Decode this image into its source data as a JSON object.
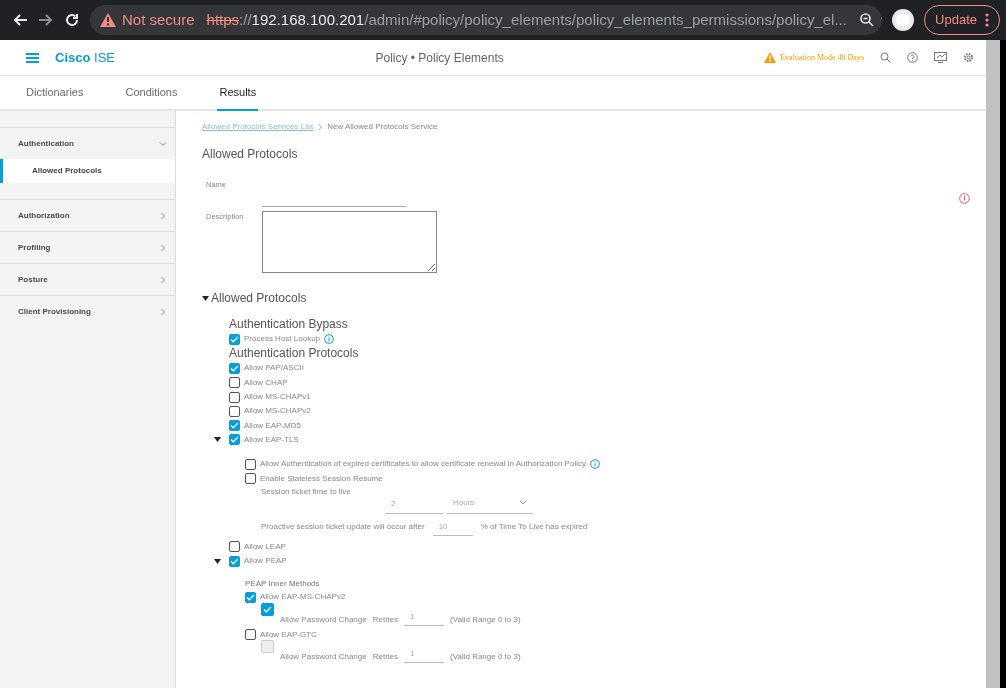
{
  "browser": {
    "security": "Not secure",
    "url_scheme": "https",
    "url_sep": "://",
    "url_host": "192.168.100.201",
    "url_path": "/admin/#policy/policy_elements/policy_elements_permissions/policy_el...",
    "update_button": "Update"
  },
  "app": {
    "brand": "Cisco",
    "brand_suffix": "ISE",
    "page_title": "Policy • Policy Elements",
    "evaluation": "Evaluation Mode 49 Days"
  },
  "tabs": [
    {
      "label": "Dictionaries",
      "selected": false
    },
    {
      "label": "Conditions",
      "selected": false
    },
    {
      "label": "Results",
      "selected": true
    }
  ],
  "sidebar": {
    "sections": [
      {
        "label": "Authentication",
        "expanded": true,
        "children": [
          {
            "label": "Allowed Protocols",
            "selected": true
          }
        ]
      },
      {
        "label": "Authorization",
        "expanded": false
      },
      {
        "label": "Profiling",
        "expanded": false
      },
      {
        "label": "Posture",
        "expanded": false
      },
      {
        "label": "Client Provisioning",
        "expanded": false
      }
    ]
  },
  "breadcrumb": [
    "Allowed Protocols Services List",
    "New Allowed Protocols Service"
  ],
  "heading": "Allowed Protocols",
  "form": {
    "name_label": "Name",
    "description_label": "Description"
  },
  "section": {
    "title": "Allowed Protocols",
    "expanded": true
  },
  "protocols": [
    {
      "kind": "heading",
      "text": "Authentication Bypass"
    },
    {
      "kind": "checkbox",
      "label": "Process Host Lookup",
      "checked": true,
      "info": true
    },
    {
      "kind": "heading",
      "text": "Authentication Protocols"
    },
    {
      "kind": "checkbox",
      "label": "Allow PAP/ASCII",
      "checked": true
    },
    {
      "kind": "checkbox",
      "label": "Allow CHAP",
      "checked": false
    },
    {
      "kind": "checkbox",
      "label": "Allow MS-CHAPv1",
      "checked": false
    },
    {
      "kind": "checkbox",
      "label": "Allow MS-CHAPv2",
      "checked": false
    },
    {
      "kind": "checkbox",
      "label": "Allow EAP-MD5",
      "checked": true
    },
    {
      "kind": "checkbox",
      "label": "Allow EAP-TLS",
      "checked": true,
      "expanded": true,
      "children": [
        {
          "kind": "checkbox",
          "label": "Allow Authentication of expired certificates to allow certificate renewal in Authorization Policy",
          "checked": false,
          "info": true
        },
        {
          "kind": "checkbox",
          "label": "Enable Stateless Session Resume",
          "checked": false
        },
        {
          "kind": "ttl",
          "label": "Session ticket time to live",
          "value": "2",
          "unit": "Hours"
        },
        {
          "kind": "proactive",
          "label": "Proactive session ticket update will occur after",
          "value": "10",
          "suffix": "% of Time To Live has expired"
        }
      ]
    },
    {
      "kind": "checkbox",
      "label": "Allow LEAP",
      "checked": false
    },
    {
      "kind": "checkbox",
      "label": "Allow PEAP",
      "checked": true,
      "expanded": true,
      "children": [
        {
          "kind": "subheading",
          "text": "PEAP Inner Methods"
        },
        {
          "kind": "checkbox",
          "label": "Allow EAP-MS-CHAPv2",
          "checked": true
        },
        {
          "kind": "password",
          "label": "Allow Password Change",
          "checked": true,
          "disabled": false,
          "retries_label": "Retries",
          "retries": "1",
          "range": "(Valid Range 0 to 3)"
        },
        {
          "kind": "checkbox",
          "label": "Allow EAP-GTC",
          "checked": false
        },
        {
          "kind": "password",
          "label": "Allow Password Change",
          "checked": false,
          "disabled": true,
          "retries_label": "Retries",
          "retries": "1",
          "range": "(Valid Range 0 to 3)"
        }
      ]
    }
  ]
}
